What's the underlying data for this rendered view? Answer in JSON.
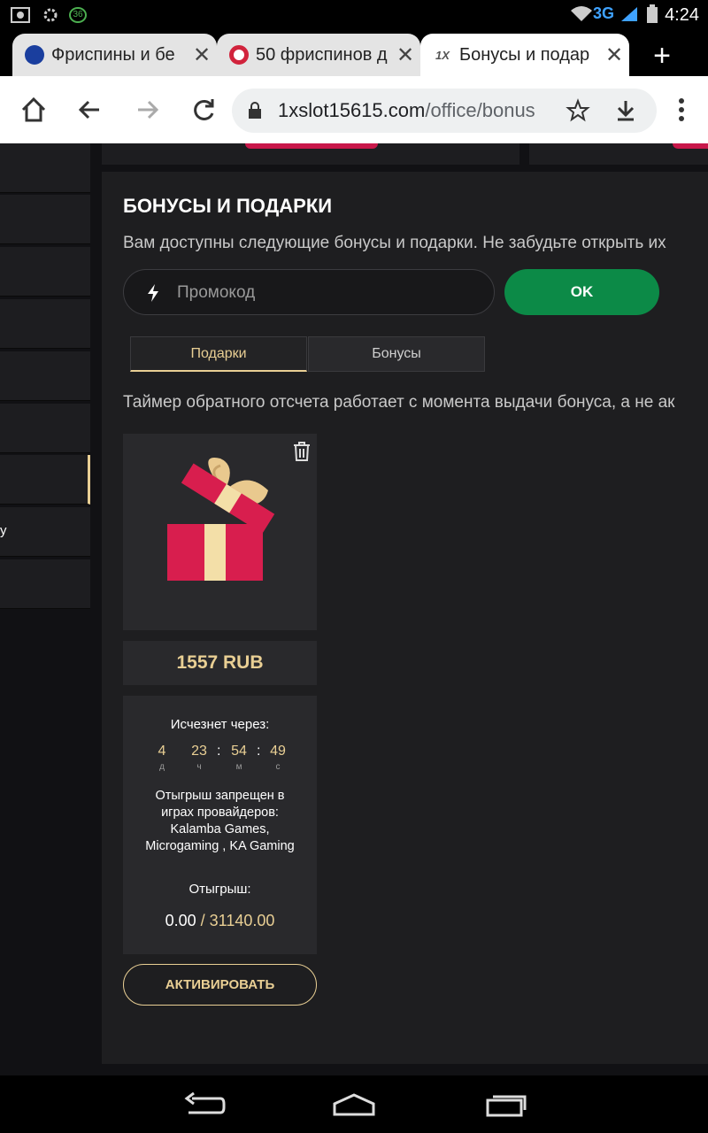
{
  "status_bar": {
    "network": "3G",
    "time": "4:24",
    "badge": "36"
  },
  "browser": {
    "tabs": [
      {
        "title": "Фриспины и бе",
        "favicon_color": "#1a3e9e"
      },
      {
        "title": "50 фриспинов д",
        "favicon_color": "#d1233c"
      },
      {
        "title": "Бонусы и подар",
        "favicon_label": "1X",
        "active": true
      }
    ],
    "url_host": "1xslot15615.com",
    "url_path": "/office/bonus"
  },
  "sidebar": {
    "items": [
      {
        "label": "у"
      }
    ]
  },
  "bonuses": {
    "title": "БОНУСЫ И ПОДАРКИ",
    "subtitle": "Вам доступны следующие бонусы и подарки. Не забудьте открыть их",
    "promo_placeholder": "Промокод",
    "ok_label": "OK",
    "tabs": [
      {
        "label": "Подарки",
        "selected": true
      },
      {
        "label": "Бонусы",
        "selected": false
      }
    ],
    "timer_note": "Таймер обратного отсчета работает с момента выдачи бонуса, а не ак",
    "gift": {
      "amount": "1557 RUB",
      "expires_label": "Исчезнет через:",
      "countdown": [
        {
          "value": "4",
          "unit": "д"
        },
        {
          "value": "23",
          "unit": "ч"
        },
        {
          "value": "54",
          "unit": "м"
        },
        {
          "value": "49",
          "unit": "с"
        }
      ],
      "separator": ":",
      "restriction": "Отыгрыш запрещен в играх провайдеров: Kalamba Games, Microgaming , KA Gaming",
      "wager_label": "Отыгрыш:",
      "wager_current": "0.00",
      "wager_slash": "/",
      "wager_target": "31140.00",
      "activate_label": "АКТИВИРОВАТЬ"
    }
  },
  "colors": {
    "accent_gold": "#e9cf94",
    "ok_green": "#0c8a47",
    "gift_pink": "#d81e4e"
  }
}
